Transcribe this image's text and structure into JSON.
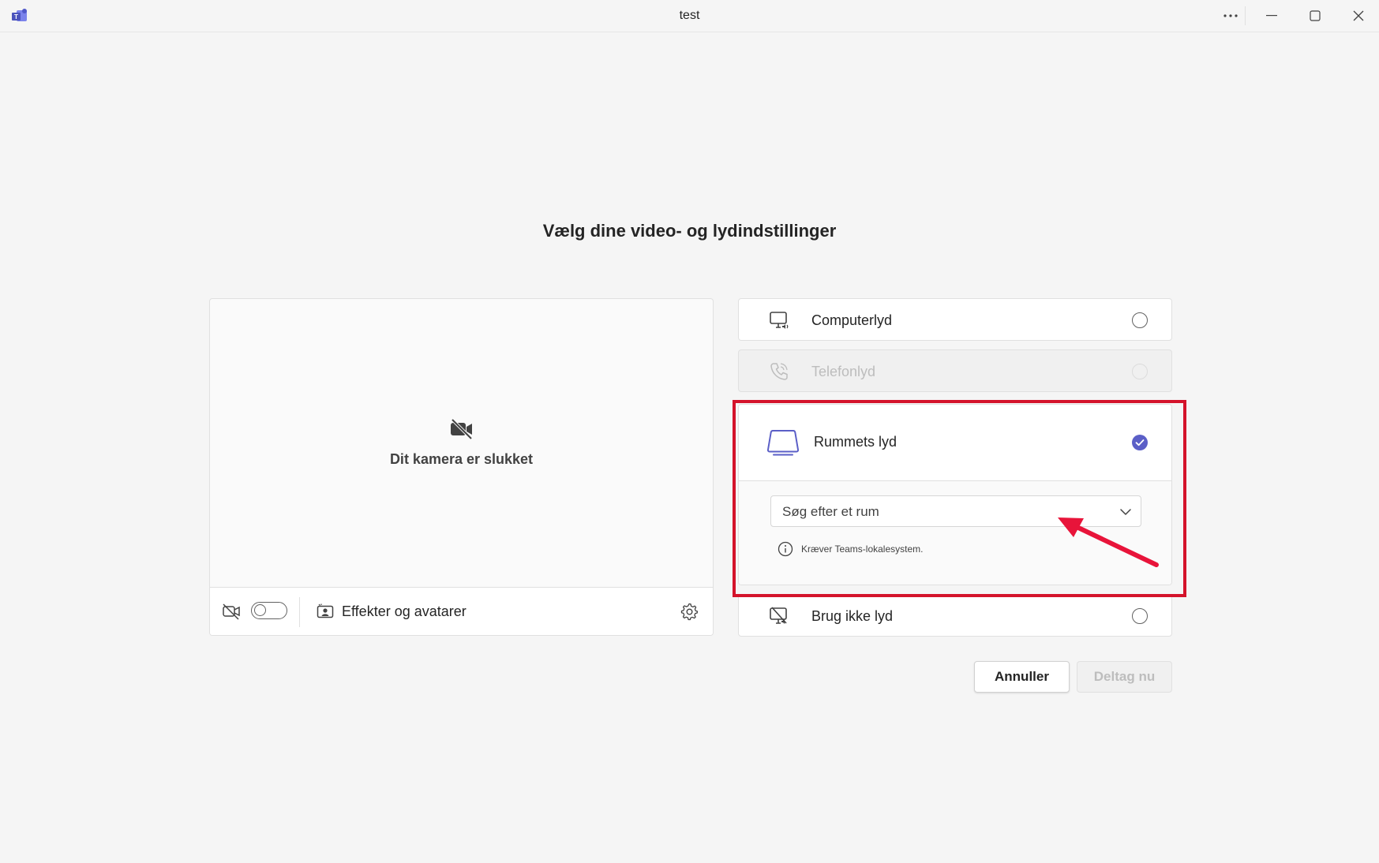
{
  "window": {
    "title": "test"
  },
  "heading": "Vælg dine video- og lydindstillinger",
  "camera": {
    "off_text": "Dit kamera er slukket",
    "toggle_on": false,
    "effects_label": "Effekter og avatarer"
  },
  "audio_options": {
    "computer": {
      "label": "Computerlyd",
      "selected": false
    },
    "phone": {
      "label": "Telefonlyd",
      "disabled": true
    },
    "room": {
      "label": "Rummets lyd",
      "selected": true,
      "search_value": "Søg efter et rum",
      "info": "Kræver Teams-lokalesystem."
    },
    "none": {
      "label": "Brug ikke lyd",
      "selected": false
    }
  },
  "actions": {
    "cancel": "Annuller",
    "join": "Deltag nu"
  },
  "colors": {
    "accent": "#5b5fc7",
    "highlight": "#d4132b"
  },
  "icons": [
    "teams-icon",
    "more-icon",
    "minimize-icon",
    "maximize-icon",
    "close-icon",
    "camera-off-icon",
    "video-off-icon",
    "effects-icon",
    "gear-icon",
    "computer-audio-icon",
    "phone-icon",
    "room-icon",
    "chevron-down-icon",
    "info-icon",
    "no-audio-icon",
    "checkmark-icon"
  ]
}
